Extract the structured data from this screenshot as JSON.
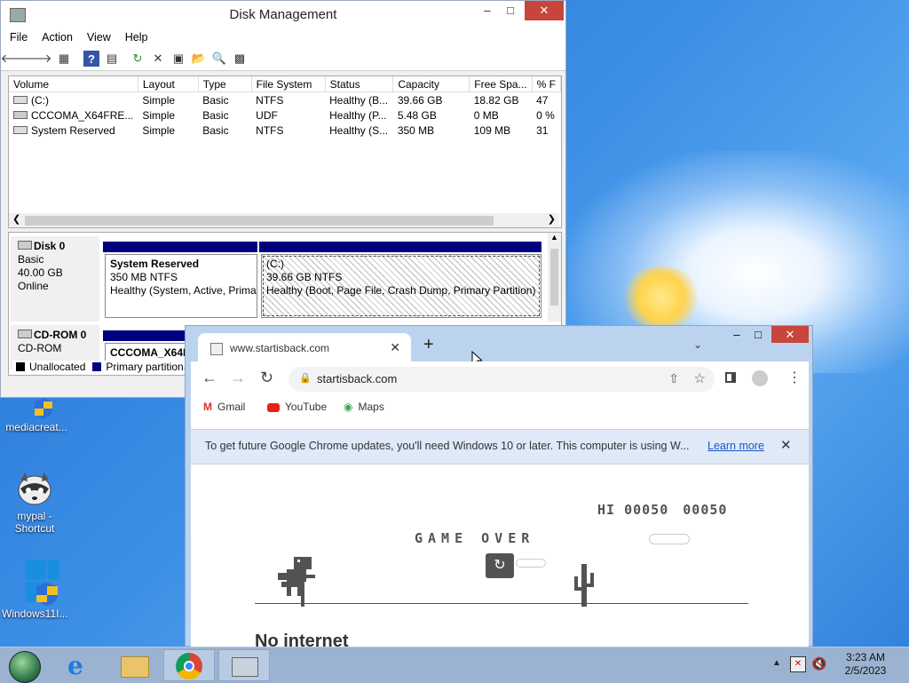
{
  "desktop": {
    "icons": [
      {
        "label": "mediacreat..."
      },
      {
        "label": "mypal - Shortcut"
      },
      {
        "label": "Windows11I..."
      }
    ]
  },
  "disk_management": {
    "title": "Disk Management",
    "menu": [
      "File",
      "Action",
      "View",
      "Help"
    ],
    "columns": [
      "Volume",
      "Layout",
      "Type",
      "File System",
      "Status",
      "Capacity",
      "Free Spa...",
      "% F"
    ],
    "rows": [
      [
        "(C:)",
        "Simple",
        "Basic",
        "NTFS",
        "Healthy (B...",
        "39.66 GB",
        "18.82 GB",
        "47"
      ],
      [
        "CCCOMA_X64FRE...",
        "Simple",
        "Basic",
        "UDF",
        "Healthy (P...",
        "5.48 GB",
        "0 MB",
        "0 %"
      ],
      [
        "System Reserved",
        "Simple",
        "Basic",
        "NTFS",
        "Healthy (S...",
        "350 MB",
        "109 MB",
        "31"
      ]
    ],
    "disk0": {
      "name": "Disk 0",
      "type": "Basic",
      "size": "40.00 GB",
      "status": "Online",
      "partitions": [
        {
          "name": "System Reserved",
          "size": "350 MB NTFS",
          "status": "Healthy (System, Active, Prima"
        },
        {
          "name": "(C:)",
          "size": "39.66 GB NTFS",
          "status": "Healthy (Boot, Page File, Crash Dump, Primary Partition)"
        }
      ]
    },
    "cdrom0": {
      "name": "CD-ROM 0",
      "type": "CD-ROM",
      "partition_name": "CCCOMA_X64FI"
    },
    "legend": [
      "Unallocated",
      "Primary partition"
    ]
  },
  "chrome": {
    "tab_title": "www.startisback.com",
    "url": "startisback.com",
    "bookmarks": [
      "Gmail",
      "YouTube",
      "Maps"
    ],
    "infobar_text": "To get future Google Chrome updates, you'll need Windows 10 or later. This computer is using W...",
    "infobar_link": "Learn more",
    "game": {
      "hi_label": "HI",
      "hi_score": "00050",
      "score": "00050",
      "game_over": "GAME OVER"
    },
    "no_internet": "No internet"
  },
  "taskbar": {
    "time": "3:23 AM",
    "date": "2/5/2023"
  },
  "colors": {
    "primary_partition": "#00007f",
    "unallocated": "#000000",
    "chrome_frame": "#bcd3ef",
    "close_red": "#c7453b"
  }
}
